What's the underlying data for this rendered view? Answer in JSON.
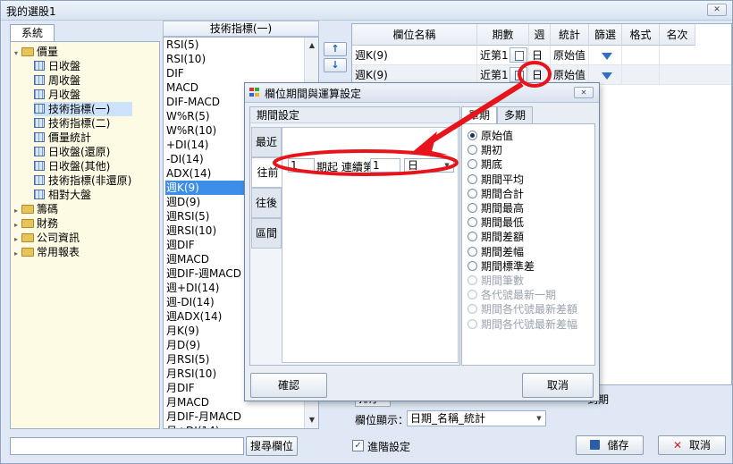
{
  "window": {
    "title": "我的選股1",
    "close_label": "✕"
  },
  "left_panel": {
    "tab": "系統",
    "tree": [
      {
        "label": "價量",
        "kind": "folder",
        "expanded": true
      },
      {
        "label": "日收盤",
        "kind": "grid"
      },
      {
        "label": "周收盤",
        "kind": "grid"
      },
      {
        "label": "月收盤",
        "kind": "grid"
      },
      {
        "label": "技術指標(一)",
        "kind": "grid",
        "selected": true
      },
      {
        "label": "技術指標(二)",
        "kind": "grid"
      },
      {
        "label": "價量統計",
        "kind": "grid"
      },
      {
        "label": "日收盤(還原)",
        "kind": "grid"
      },
      {
        "label": "日收盤(其他)",
        "kind": "grid"
      },
      {
        "label": "技術指標(非還原)",
        "kind": "grid"
      },
      {
        "label": "相對大盤",
        "kind": "grid"
      },
      {
        "label": "籌碼",
        "kind": "folder"
      },
      {
        "label": "財務",
        "kind": "folder"
      },
      {
        "label": "公司資訊",
        "kind": "folder"
      },
      {
        "label": "常用報表",
        "kind": "folder"
      }
    ]
  },
  "indicator_list": {
    "header": "技術指標(一)",
    "items": [
      "RSI(5)",
      "RSI(10)",
      "DIF",
      "MACD",
      "DIF-MACD",
      "W%R(5)",
      "W%R(10)",
      "+DI(14)",
      "-DI(14)",
      "ADX(14)",
      "週K(9)",
      "週D(9)",
      "週RSI(5)",
      "週RSI(10)",
      "週DIF",
      "週MACD",
      "週DIF-週MACD",
      "週+DI(14)",
      "週-DI(14)",
      "週ADX(14)",
      "月K(9)",
      "月D(9)",
      "月RSI(5)",
      "月RSI(10)",
      "月DIF",
      "月MACD",
      "月DIF-月MACD",
      "月+DI(14)"
    ],
    "selected": "週K(9)"
  },
  "move_buttons": {
    "up": "↑",
    "down": "↓"
  },
  "columns_grid": {
    "headers": [
      "欄位名稱",
      "期數",
      "週期",
      "統計",
      "篩選",
      "格式",
      "名次"
    ],
    "rows": [
      {
        "name": "週K(9)",
        "period": "近第1",
        "cycle": "日",
        "stat": "原始值"
      },
      {
        "name": "週K(9)",
        "period": "近第1",
        "cycle": "日",
        "stat": "原始值"
      }
    ]
  },
  "bottom": {
    "sort_label": "排序",
    "to_period_label": "到期",
    "display_label": "欄位顯示：",
    "display_value": "日期_名稱_統計",
    "advanced_label": "進階設定",
    "advanced_checked": true,
    "search_button": "搜尋欄位",
    "search_value": "",
    "save_button": "儲存",
    "cancel_button": "取消"
  },
  "dialog": {
    "title": "欄位期間與運算設定",
    "period_group": "期間設定",
    "period_tabs": [
      "最近",
      "往前",
      "往後",
      "區間"
    ],
    "active_tab": "往前",
    "row": {
      "value1": "1",
      "text1": "期起 連續第",
      "value2": "1",
      "unit": "日"
    },
    "calc_tabs": [
      "單期",
      "多期"
    ],
    "options": [
      {
        "label": "原始值",
        "checked": true,
        "enabled": true
      },
      {
        "label": "期初",
        "enabled": true
      },
      {
        "label": "期底",
        "enabled": true
      },
      {
        "label": "期間平均",
        "enabled": true
      },
      {
        "label": "期間合計",
        "enabled": true
      },
      {
        "label": "期間最高",
        "enabled": true
      },
      {
        "label": "期間最低",
        "enabled": true
      },
      {
        "label": "期間差額",
        "enabled": true
      },
      {
        "label": "期間差幅",
        "enabled": true
      },
      {
        "label": "期間標準差",
        "enabled": true
      },
      {
        "label": "期間筆數",
        "enabled": false
      },
      {
        "label": "各代號最新一期",
        "enabled": false
      },
      {
        "label": "期間各代號最新差額",
        "enabled": false
      },
      {
        "label": "期間各代號最新差幅",
        "enabled": false
      }
    ],
    "ok_button": "確認",
    "cancel_button": "取消"
  },
  "colors": {
    "annotation_red": "#e8141c",
    "selection_blue": "#3d8ee9",
    "tree_bg": "#fdfbe4"
  }
}
